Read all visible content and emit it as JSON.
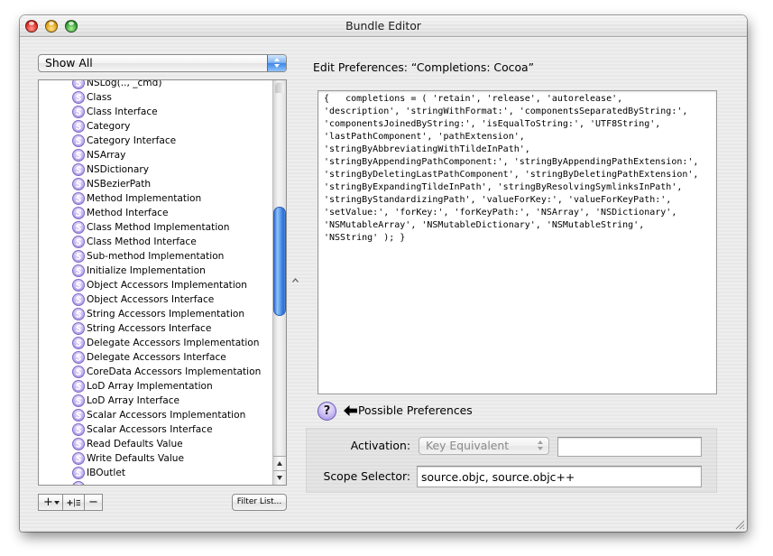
{
  "window": {
    "title": "Bundle Editor",
    "controls": [
      "close-button",
      "minimize-button",
      "zoom-button"
    ]
  },
  "sidebar": {
    "filter_popup": {
      "selected": "Show All"
    },
    "item_icon": "snippet-icon",
    "items": [
      {
        "label": "NSLog(.., _cmd)"
      },
      {
        "label": "Class"
      },
      {
        "label": "Class Interface"
      },
      {
        "label": "Category"
      },
      {
        "label": "Category Interface"
      },
      {
        "label": "NSArray"
      },
      {
        "label": "NSDictionary"
      },
      {
        "label": "NSBezierPath"
      },
      {
        "label": "Method Implementation"
      },
      {
        "label": "Method Interface"
      },
      {
        "label": "Class Method Implementation"
      },
      {
        "label": "Class Method Interface"
      },
      {
        "label": "Sub-method Implementation"
      },
      {
        "label": "Initialize Implementation"
      },
      {
        "label": "Object Accessors Implementation"
      },
      {
        "label": "Object Accessors Interface"
      },
      {
        "label": "String Accessors Implementation"
      },
      {
        "label": "String Accessors Interface"
      },
      {
        "label": "Delegate Accessors Implementation"
      },
      {
        "label": "Delegate Accessors Interface"
      },
      {
        "label": "CoreData Accessors Implementation"
      },
      {
        "label": "LoD Array Implementation"
      },
      {
        "label": "LoD Array Interface"
      },
      {
        "label": "Scalar Accessors Implementation"
      },
      {
        "label": "Scalar Accessors Interface"
      },
      {
        "label": "Read Defaults Value"
      },
      {
        "label": "Write Defaults Value"
      },
      {
        "label": "IBOutlet"
      }
    ],
    "footer": {
      "add_label": "+",
      "add_menu_icon": "chevron-down-icon",
      "duplicate_icon": "duplicate-icon",
      "remove_label": "−",
      "filter_button": "Filter List..."
    }
  },
  "editor": {
    "heading": "Edit Preferences: “Completions: Cocoa”",
    "content": "{   completions = ( 'retain', 'release', 'autorelease',\n'description', 'stringWithFormat:', 'componentsSeparatedByString:',\n'componentsJoinedByString:', 'isEqualToString:', 'UTF8String',\n'lastPathComponent', 'pathExtension',\n'stringByAbbreviatingWithTildeInPath',\n'stringByAppendingPathComponent:', 'stringByAppendingPathExtension:',\n'stringByDeletingLastPathComponent', 'stringByDeletingPathExtension',\n'stringByExpandingTildeInPath', 'stringByResolvingSymlinksInPath',\n'stringByStandardizingPath', 'valueForKey:', 'valueForKeyPath:',\n'setValue:', 'forKey:', 'forKeyPath:', 'NSArray', 'NSDictionary',\n'NSMutableArray', 'NSMutableDictionary', 'NSMutableString',\n'NSString' ); }",
    "help_label": "?",
    "possible_preferences_icon": "left-arrow-icon",
    "possible_preferences_label": "Possible Preferences"
  },
  "activation": {
    "label": "Activation:",
    "popup_value": "Key Equivalent"
  },
  "scope": {
    "label": "Scope Selector:",
    "value": "source.objc, source.objc++"
  },
  "colors": {
    "accent_blue": "#3f87e6",
    "snippet_icon": "#c5b4f1",
    "window_background": "#eeeeee"
  }
}
